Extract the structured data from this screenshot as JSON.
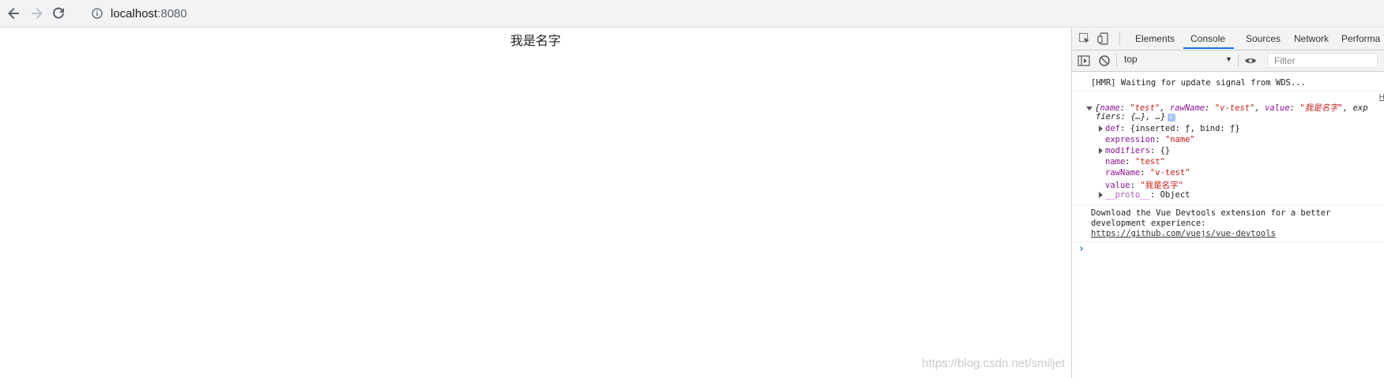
{
  "browser": {
    "back_icon": "arrow-left-icon",
    "forward_icon": "arrow-right-icon",
    "reload_icon": "reload-icon",
    "site_info_icon": "info-icon",
    "url_host": "localhost",
    "url_port": ":8080"
  },
  "page": {
    "heading": "我是名字",
    "watermark": "https://blog.csdn.net/smiljet"
  },
  "devtools": {
    "tabs": [
      "Elements",
      "Console",
      "Sources",
      "Network",
      "Performa"
    ],
    "active_tab": "Console",
    "context": "top",
    "filter_placeholder": "Filter",
    "console": {
      "hmr_message": "[HMR] Waiting for update signal from WDS...",
      "source_link": "H",
      "object_summary": {
        "open": "{",
        "k1": "name",
        "v1": "\"test\"",
        "k2": "rawName",
        "v2": "\"v-test\"",
        "k3": "value",
        "v3": "\"我是名字\"",
        "tail": ", exp",
        "line2": "fiers: {…}, …}"
      },
      "props": [
        {
          "key": "def",
          "value": "{inserted: ƒ, bind: ƒ}",
          "expandable": true,
          "is_string": false
        },
        {
          "key": "expression",
          "value": "\"name\"",
          "expandable": false,
          "is_string": true
        },
        {
          "key": "modifiers",
          "value": "{}",
          "expandable": true,
          "is_string": false
        },
        {
          "key": "name",
          "value": "\"test\"",
          "expandable": false,
          "is_string": true
        },
        {
          "key": "rawName",
          "value": "\"v-test\"",
          "expandable": false,
          "is_string": true
        },
        {
          "key": "value",
          "value": "\"我是名字\"",
          "expandable": false,
          "is_string": true
        },
        {
          "key": "__proto__",
          "value": "Object",
          "expandable": true,
          "is_string": false
        }
      ],
      "vue_msg_line1": "Download the Vue Devtools extension for a better",
      "vue_msg_line2": "development experience:",
      "vue_msg_link": "https://github.com/vuejs/vue-devtools",
      "prompt": "›"
    }
  },
  "colors": {
    "accent": "#1a73e8",
    "key": "#881391",
    "string": "#c41a16"
  }
}
